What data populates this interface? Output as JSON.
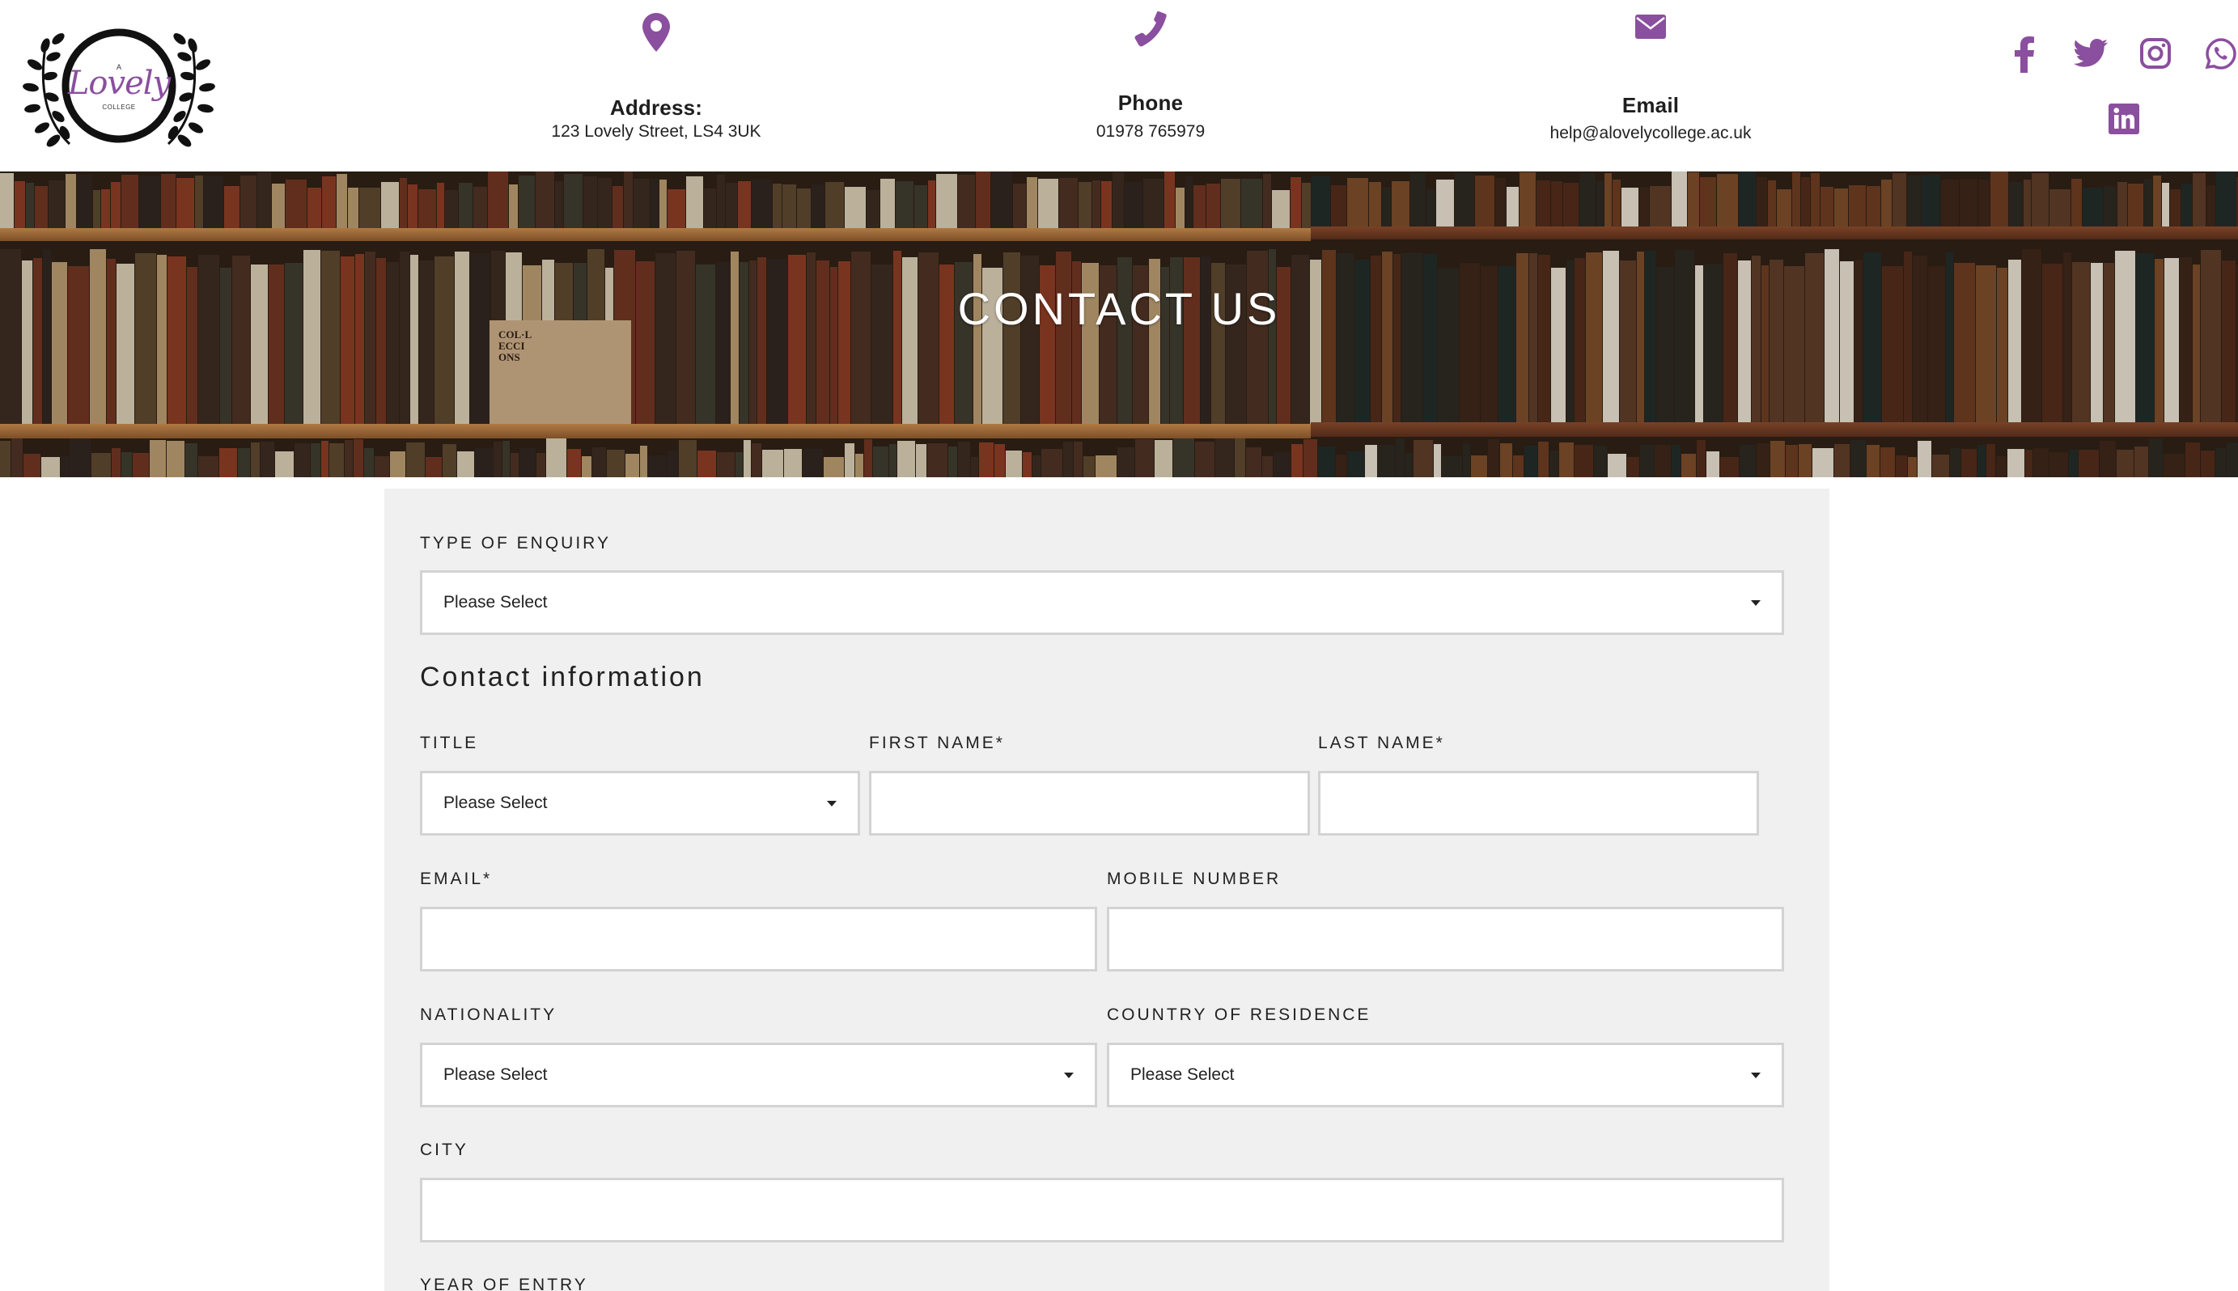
{
  "brand": {
    "logo_top": "A",
    "logo_name": "Lovely",
    "logo_bottom": "COLLEGE",
    "accent_color": "#8a4f9e"
  },
  "header": {
    "address": {
      "icon": "map-marker-icon",
      "title": "Address:",
      "value": "123 Lovely Street, LS4 3UK"
    },
    "phone": {
      "icon": "phone-icon",
      "title": "Phone",
      "value": "01978 765979"
    },
    "email": {
      "icon": "envelope-icon",
      "title": "Email",
      "value": "help@alovelycollege.ac.uk"
    },
    "social": [
      "facebook-icon",
      "twitter-icon",
      "instagram-icon",
      "whatsapp-icon",
      "linkedin-icon"
    ]
  },
  "hero": {
    "title": "CONTACT US"
  },
  "form": {
    "enquiry": {
      "label": "TYPE OF ENQUIRY",
      "value": "Please Select"
    },
    "section_title": "Contact information",
    "title": {
      "label": "TITLE",
      "value": "Please Select"
    },
    "first_name": {
      "label": "FIRST NAME*",
      "value": ""
    },
    "last_name": {
      "label": "LAST NAME*",
      "value": ""
    },
    "email": {
      "label": "EMAIL*",
      "value": ""
    },
    "mobile": {
      "label": "MOBILE NUMBER",
      "value": ""
    },
    "nationality": {
      "label": "NATIONALITY",
      "value": "Please Select"
    },
    "country": {
      "label": "COUNTRY OF RESIDENCE",
      "value": "Please Select"
    },
    "city": {
      "label": "CITY",
      "value": ""
    },
    "year_of_entry": {
      "label": "YEAR OF ENTRY"
    }
  }
}
